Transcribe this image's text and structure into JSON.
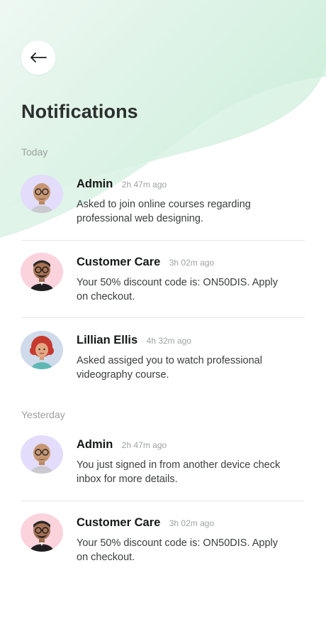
{
  "header": {
    "title": "Notifications",
    "back_icon": "arrow-left-icon"
  },
  "colors": {
    "bg_accent": "#cdeedb",
    "avatar_purple": "#e3dcfb",
    "avatar_pink": "#fbd3dc",
    "avatar_blue": "#cfdaea",
    "muted_text": "#9aa09d"
  },
  "sections": [
    {
      "label": "Today",
      "items": [
        {
          "name": "Admin",
          "time": "2h 47m ago",
          "message": "Asked to join online courses regarding professional web designing.",
          "avatar": "admin-avatar"
        },
        {
          "name": "Customer Care",
          "time": "3h 02m ago",
          "message": "Your 50% discount code is: ON50DIS. Apply on checkout.",
          "avatar": "customer-care-avatar"
        },
        {
          "name": "Lillian Ellis",
          "time": "4h 32m ago",
          "message": "Asked assiged you to watch professional videography course.",
          "avatar": "lillian-avatar"
        }
      ]
    },
    {
      "label": "Yesterday",
      "items": [
        {
          "name": "Admin",
          "time": "2h 47m ago",
          "message": "You just signed in from another device check inbox for more details.",
          "avatar": "admin-avatar"
        },
        {
          "name": "Customer Care",
          "time": "3h 02m ago",
          "message": "Your 50% discount code is: ON50DIS. Apply on checkout.",
          "avatar": "customer-care-avatar"
        }
      ]
    }
  ]
}
